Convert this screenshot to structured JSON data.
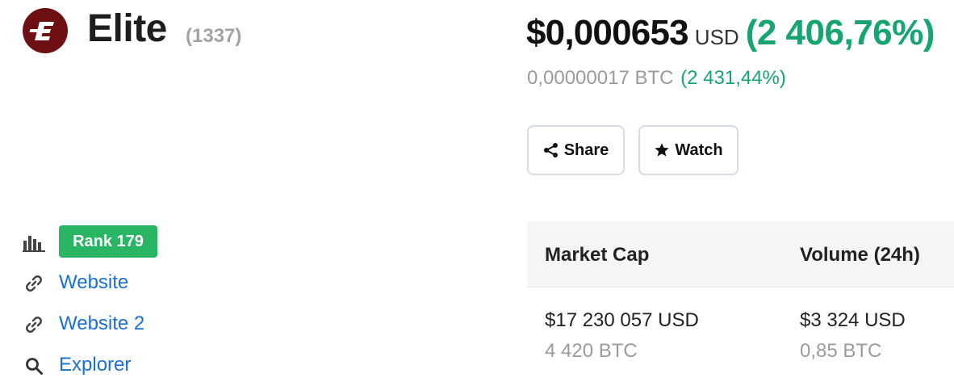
{
  "coin": {
    "name": "Elite",
    "symbol": "(1337)",
    "logo_icon": "elite-e-logo",
    "logo_color": "#6e0f14"
  },
  "price": {
    "usd_value": "$0,000653",
    "usd_currency": "USD",
    "usd_change": "(2 406,76%)",
    "btc_value": "0,00000017 BTC",
    "btc_change": "(2 431,44%)",
    "positive_color": "#16a56e"
  },
  "actions": {
    "share_label": "Share",
    "share_icon": "share-icon",
    "watch_label": "Watch",
    "watch_icon": "star-icon"
  },
  "sidebar": {
    "rank": {
      "icon": "bar-chart-icon",
      "label": "Rank 179",
      "color": "#2ab565"
    },
    "links": [
      {
        "icon": "link-icon",
        "label": "Website"
      },
      {
        "icon": "link-icon",
        "label": "Website 2"
      },
      {
        "icon": "search-icon",
        "label": "Explorer"
      }
    ]
  },
  "stats": {
    "columns": [
      {
        "label": "Market Cap",
        "usd": "$17 230 057 USD",
        "btc": "4 420 BTC"
      },
      {
        "label": "Volume (24h)",
        "usd": "$3 324 USD",
        "btc": "0,85 BTC"
      }
    ]
  }
}
